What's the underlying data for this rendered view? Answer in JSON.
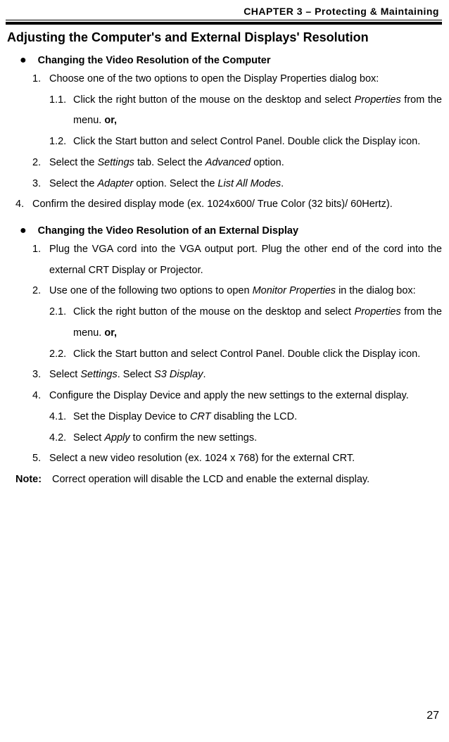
{
  "chapter_header": "CHAPTER 3 – Protecting & Maintaining",
  "section_title": "Adjusting the Computer's and External Displays' Resolution",
  "a": {
    "bullet": "Changing the Video Resolution of the Computer",
    "i1_pre": "1.",
    "i1": "Choose one of the two options to open the Display Properties dialog box:",
    "i1_1_pre": "1.1.",
    "i1_1_a": "Click the right button of the mouse on the desktop and select ",
    "i1_1_b": "Properties",
    "i1_1_c": " from the menu. ",
    "i1_1_d": "or,",
    "i1_2_pre": "1.2.",
    "i1_2": "Click the Start button and select Control Panel. Double click the Display icon.",
    "i2_pre": "2.",
    "i2_a": "Select the ",
    "i2_b": "Settings",
    "i2_c": " tab. Select the ",
    "i2_d": "Advanced",
    "i2_e": " option.",
    "i3_pre": "3.",
    "i3_a": "Select the ",
    "i3_b": "Adapter",
    "i3_c": " option. Select the ",
    "i3_d": "List All Modes",
    "i3_e": ".",
    "i4_pre": "4.",
    "i4": "Confirm the desired display mode (ex. 1024x600/ True Color (32 bits)/ 60Hertz)."
  },
  "b": {
    "bullet": "Changing the Video Resolution of an External Display",
    "i1_pre": "1.",
    "i1": "Plug the VGA cord into the VGA output port. Plug the other end of the cord into the external CRT Display or Projector.",
    "i2_pre": "2.",
    "i2_a": "Use one of the following two options to open ",
    "i2_b": "Monitor Properties",
    "i2_c": " in the dialog box:",
    "i2_1_pre": "2.1.",
    "i2_1_a": "Click the right button of the mouse on the desktop and select ",
    "i2_1_b": "Properties",
    "i2_1_c": " from the menu.  ",
    "i2_1_d": "or,",
    "i2_2_pre": "2.2.",
    "i2_2": "Click the Start button and select Control Panel. Double click the Display icon.",
    "i3_pre": "3.",
    "i3_a": "Select ",
    "i3_b": "Settings",
    "i3_c": ". Select ",
    "i3_d": "S3 Display",
    "i3_e": ".",
    "i4_pre": "4.",
    "i4": "Configure the Display Device and apply the new settings to the external display.",
    "i4_1_pre": "4.1.",
    "i4_1_a": "Set the Display Device to ",
    "i4_1_b": "CRT",
    "i4_1_c": " disabling the LCD.",
    "i4_2_pre": "4.2.",
    "i4_2_a": "Select ",
    "i4_2_b": "Apply",
    "i4_2_c": " to confirm the new settings.",
    "i5_pre": "5.",
    "i5": "Select a new video resolution (ex. 1024 x 768) for the external CRT."
  },
  "note_label": "Note:",
  "note_text": "Correct operation will disable the LCD and enable the external display.",
  "page_number": "27"
}
